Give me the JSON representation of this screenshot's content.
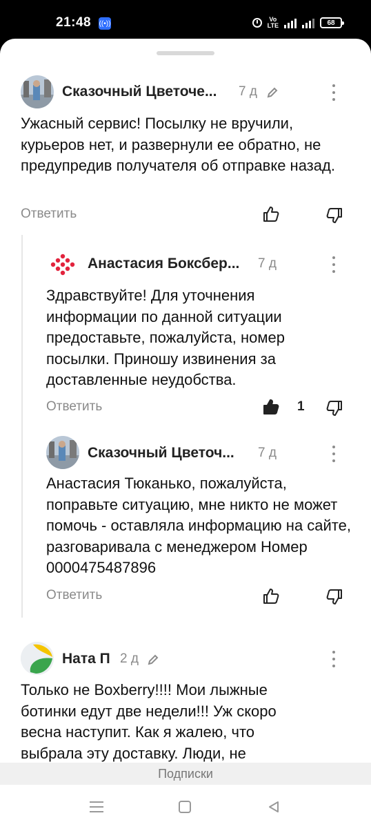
{
  "status_bar": {
    "time": "21:48",
    "lte": "Vo\nLTE",
    "network": "4G",
    "battery": "68"
  },
  "comments": [
    {
      "author": "Сказочный Цветоче...",
      "date": "7 д",
      "text": "Ужасный сервис! Посылку не вручили, курьеров нет, и развернули ее обратно, не предупредив получателя об отправке назад.",
      "reply_label": "Ответить"
    },
    {
      "author": "Анастасия Боксбер...",
      "date": "7 д",
      "text": "Здравствуйте! Для уточнения информации по данной ситуации предоставьте, пожалуйста, номер посылки. Приношу извинения за доставленные неудобства.",
      "reply_label": "Ответить",
      "likes": "1"
    },
    {
      "author": "Сказочный Цветоч...",
      "date": "7 д",
      "text": "Анастасия Тюканько, пожалуйста, поправьте ситуацию, мне никто не может помочь - оставляла информацию на сайте, разговаривала с менеджером Номер 0000475487896",
      "reply_label": "Ответить"
    },
    {
      "author": "Ната П",
      "date": "2 д",
      "text": "Только не Boxberry!!!! Мои лыжные ботинки едут две недели!!! Уж скоро весна наступит. Как я жалею, что выбрала эту доставку. Люди, не"
    }
  ],
  "subscriptions_label": "Подписки",
  "colors": {
    "accent_red": "#e2233d",
    "yellow": "#f5c400",
    "green": "#3aa54d"
  }
}
